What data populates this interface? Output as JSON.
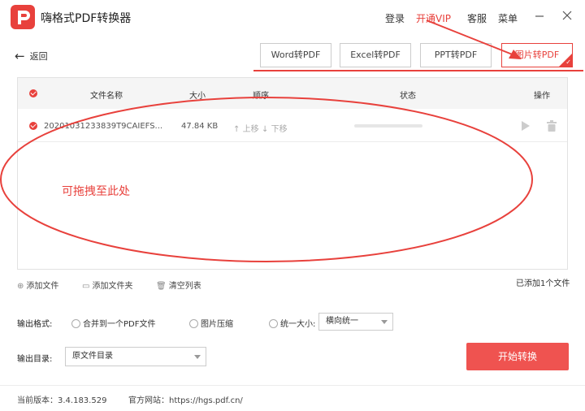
{
  "app": {
    "title": "嗨格式PDF转换器"
  },
  "header": {
    "login": "登录",
    "vip": "开通VIP",
    "service": "客服",
    "menu": "菜单"
  },
  "nav": {
    "back": "返回"
  },
  "tabs": [
    {
      "label": "Word转PDF"
    },
    {
      "label": "Excel转PDF"
    },
    {
      "label": "PPT转PDF"
    },
    {
      "label": "图片转PDF"
    }
  ],
  "table": {
    "headers": {
      "name": "文件名称",
      "size": "大小",
      "order": "顺序",
      "status": "状态",
      "actions": "操作"
    },
    "rows": [
      {
        "name": "20201031233839T9CAIEFS...",
        "size": "47.84 KB",
        "up": "上移",
        "down": "下移",
        "progress": 0
      }
    ],
    "drag_hint": "可拖拽至此处"
  },
  "file_actions": {
    "add_file": "添加文件",
    "add_folder": "添加文件夹",
    "clear": "清空列表",
    "count": "已添加1个文件"
  },
  "output": {
    "format_label": "输出格式:",
    "merge": "合并到一个PDF文件",
    "compress": "图片压缩",
    "unify": "统一大小:",
    "unify_select": "横向统一",
    "dir_label": "输出目录:",
    "dir_select": "原文件目录"
  },
  "start_button": "开始转换",
  "footer": {
    "version": "当前版本：3.4.183.529",
    "website": "官方网站：https://hgs.pdf.cn/"
  },
  "colors": {
    "accent": "#e8413c",
    "button": "#ef5350"
  }
}
